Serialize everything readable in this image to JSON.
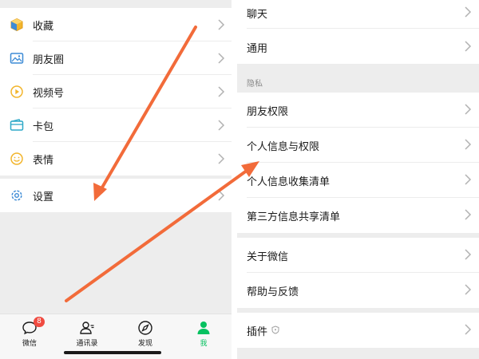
{
  "left_menu": {
    "items": [
      {
        "label": "收藏",
        "icon": "favorites-cube-icon"
      },
      {
        "label": "朋友圈",
        "icon": "moments-picture-icon"
      },
      {
        "label": "视频号",
        "icon": "channels-play-icon"
      },
      {
        "label": "卡包",
        "icon": "card-wallet-icon"
      },
      {
        "label": "表情",
        "icon": "sticker-smile-icon"
      }
    ],
    "settings": {
      "label": "设置",
      "icon": "settings-gear-icon"
    }
  },
  "tab_bar": {
    "tabs": [
      {
        "label": "微信",
        "icon": "chats-bubble-icon",
        "badge": "8"
      },
      {
        "label": "通讯录",
        "icon": "contacts-person-icon"
      },
      {
        "label": "发现",
        "icon": "discover-compass-icon"
      },
      {
        "label": "我",
        "icon": "me-person-icon",
        "active": true
      }
    ]
  },
  "settings_page": {
    "top_items": [
      "聊天",
      "通用"
    ],
    "privacy_header": "隐私",
    "privacy_items": [
      "朋友权限",
      "个人信息与权限",
      "个人信息收集清单",
      "第三方信息共享清单"
    ],
    "about_items": [
      "关于微信",
      "帮助与反馈"
    ],
    "plugins": {
      "label": "插件"
    }
  },
  "colors": {
    "accent_green": "#07c160",
    "badge_red": "#f04b41",
    "arrow_orange": "#f26b3a",
    "icon_blue": "#3d8bd6",
    "icon_yellow": "#f2b52c",
    "separator_gray": "#ededed"
  }
}
